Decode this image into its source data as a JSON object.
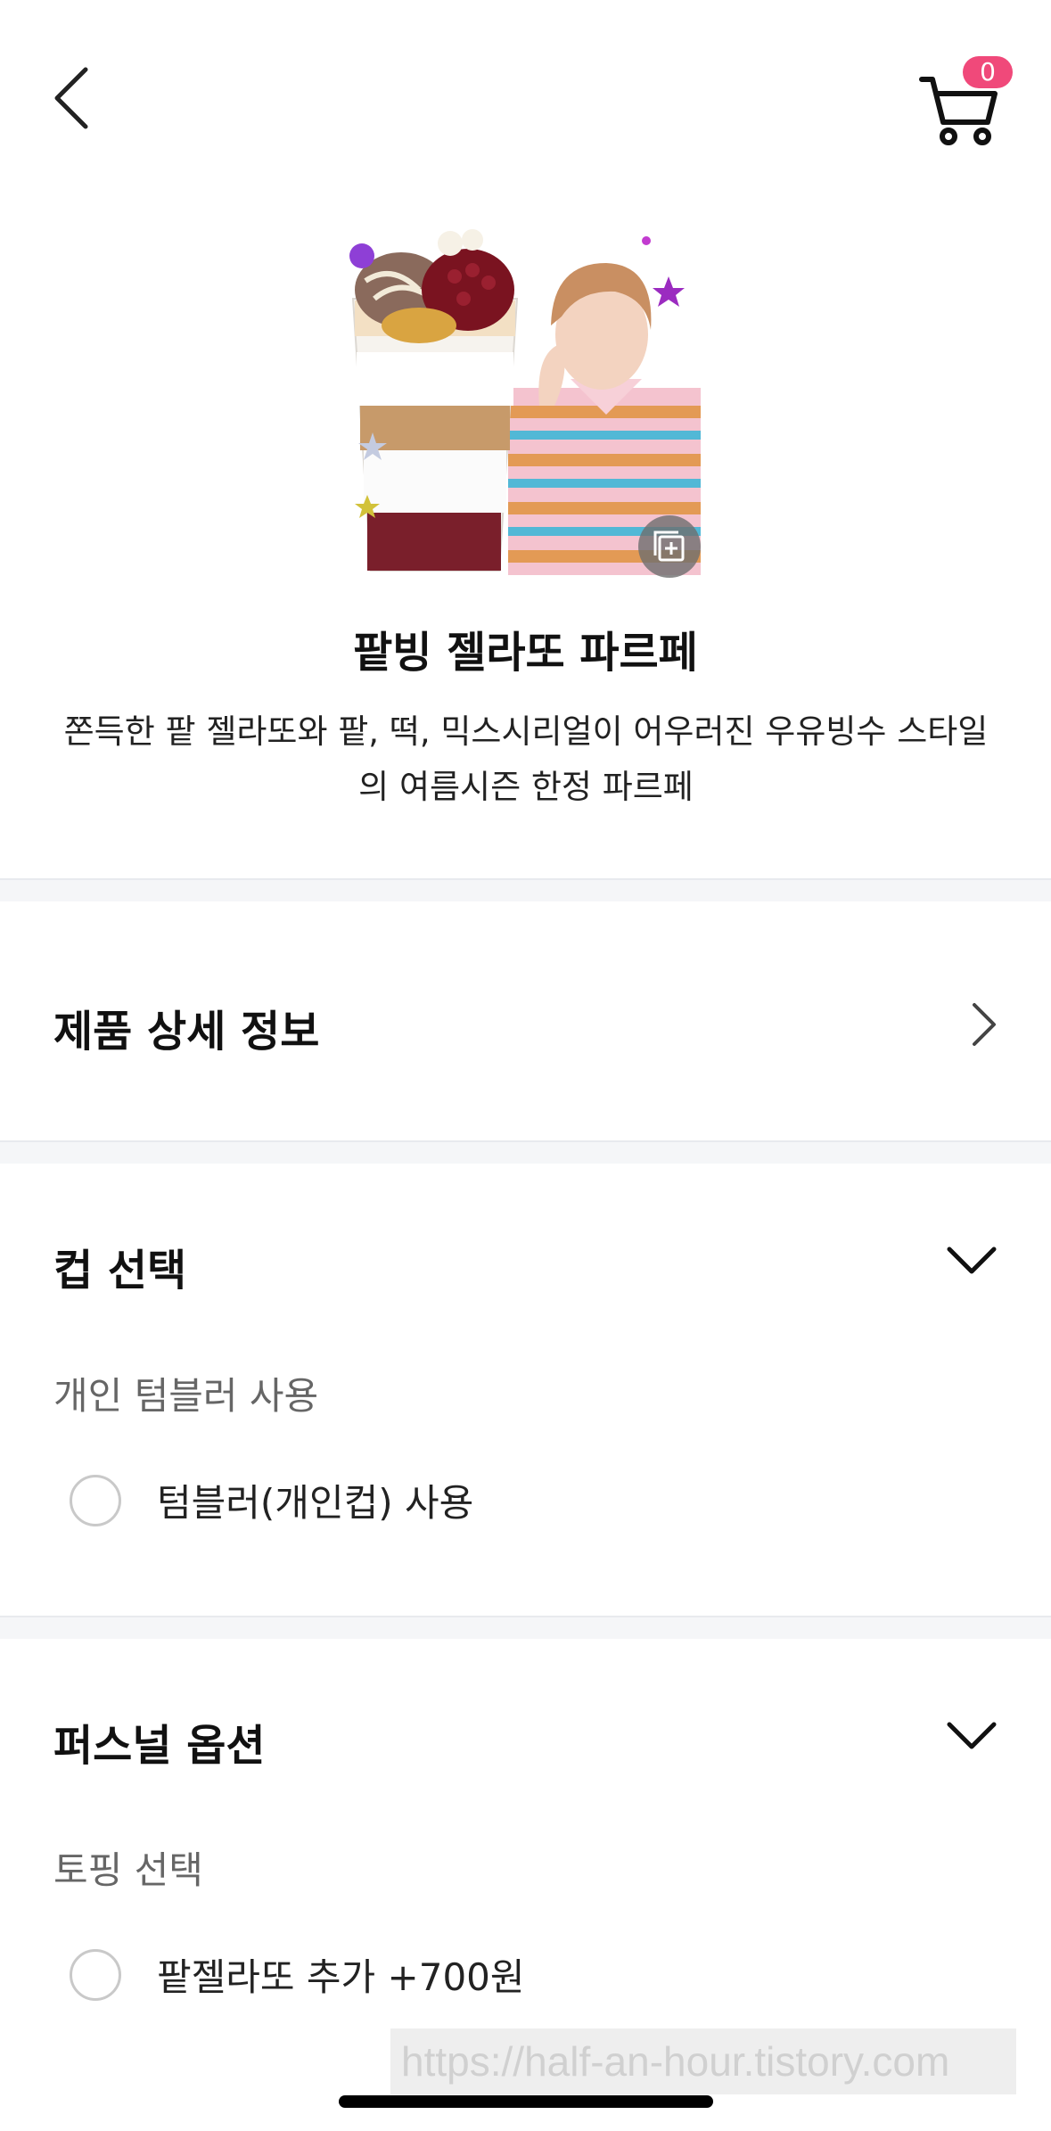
{
  "header": {
    "back_icon": "chevron-left-icon",
    "cart_icon": "cart-icon",
    "cart_count": "0"
  },
  "product": {
    "name": "팥빙 젤라또 파르페",
    "description": "쫀득한 팥 젤라또와 팥, 떡, 믹스시리얼이 어우러진 우유빙수 스타일의 여름시즌 한정 파르페"
  },
  "detail_info": {
    "label": "제품 상세 정보"
  },
  "cup_section": {
    "title": "컵 선택",
    "sub_label": "개인 텀블러 사용",
    "option_label": "텀블러(개인컵) 사용"
  },
  "personal_section": {
    "title": "퍼스널 옵션",
    "sub_label": "토핑 선택",
    "option_label": "팥젤라또 추가 +700원"
  },
  "watermark": {
    "text": "https://half-an-hour.tistory.com"
  },
  "colors": {
    "badge": "#f0497a",
    "divider": "#f5f6f8"
  }
}
